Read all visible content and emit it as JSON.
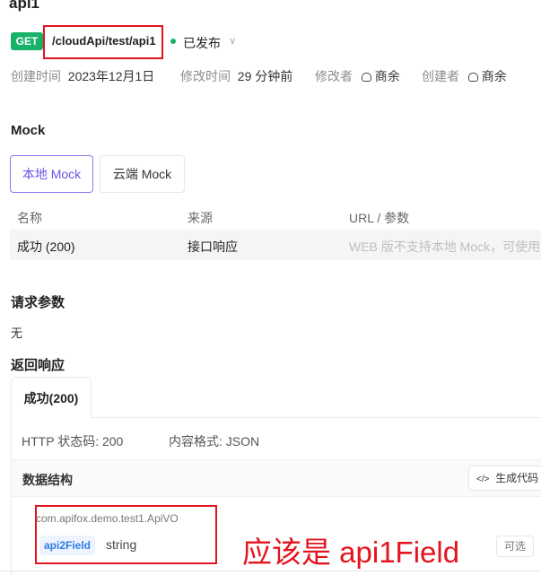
{
  "api": {
    "title": "api1",
    "method": "GET",
    "path": "/cloudApi/test/api1",
    "status": "已发布",
    "status_color": "#17b26a"
  },
  "meta": {
    "created_time_label": "创建时间",
    "created_time_value": "2023年12月1日",
    "modified_time_label": "修改时间",
    "modified_time_value": "29 分钟前",
    "modifier_label": "修改者",
    "modifier_value": "商余",
    "creator_label": "创建者",
    "creator_value": "商余"
  },
  "mock": {
    "section_title": "Mock",
    "tabs": [
      {
        "label": "本地 Mock",
        "active": true
      },
      {
        "label": "云端 Mock",
        "active": false
      }
    ],
    "table": {
      "headers": [
        "名称",
        "来源",
        "URL / 参数"
      ],
      "rows": [
        {
          "name": "成功 (200)",
          "source": "接口响应",
          "url": "WEB 版不支持本地 Mock，可使用"
        }
      ]
    }
  },
  "request": {
    "section_title": "请求参数",
    "value": "无"
  },
  "response": {
    "section_title": "返回响应",
    "tab_label": "成功(200)",
    "http_status": "HTTP 状态码: 200",
    "content_format": "内容格式: JSON",
    "schema_label": "数据结构",
    "generate_code_label": "生成代码",
    "class_name": "com.apifox.demo.test1.ApiVO",
    "field_name": "api2Field",
    "field_type": "string",
    "field_required": "可选"
  },
  "annotation": {
    "text": "应该是 api1Field",
    "color": "#e3141e"
  },
  "colors": {
    "accent": "#6b57e6",
    "get_badge": "#17b26a",
    "field_name": "#2f7ae5"
  }
}
